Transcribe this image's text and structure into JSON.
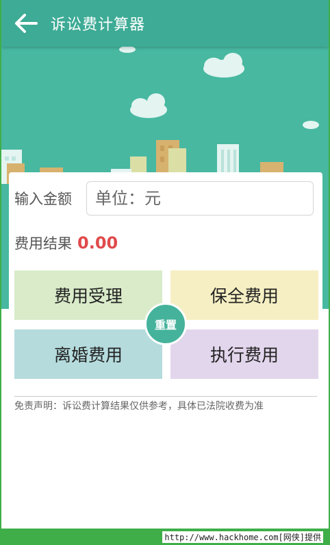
{
  "app": {
    "title": "诉讼费计算器"
  },
  "form": {
    "amount_label": "输入金额",
    "amount_placeholder": "单位：元",
    "amount_value": "",
    "result_label": "费用结果",
    "result_value": "0.00"
  },
  "buttons": [
    {
      "label": "费用受理"
    },
    {
      "label": "保全费用"
    },
    {
      "label": "离婚费用"
    },
    {
      "label": "执行费用"
    }
  ],
  "reset_label": "重置",
  "disclaimer": "免责声明：诉讼费计算结果仅供参考，具体已法院收费为准",
  "watermark": "http://www.hackhome.com[网侠]提供",
  "colors": {
    "primary": "#3dab95",
    "banner": "#48b8a1",
    "result": "#e04a4a",
    "btn_accept": "#d9ebc9",
    "btn_preserve": "#f6efc3",
    "btn_divorce": "#b5dbdd",
    "btn_execute": "#e2d6ec",
    "frame": "#3fae49"
  },
  "icons": {
    "back": "arrow-left-icon"
  }
}
